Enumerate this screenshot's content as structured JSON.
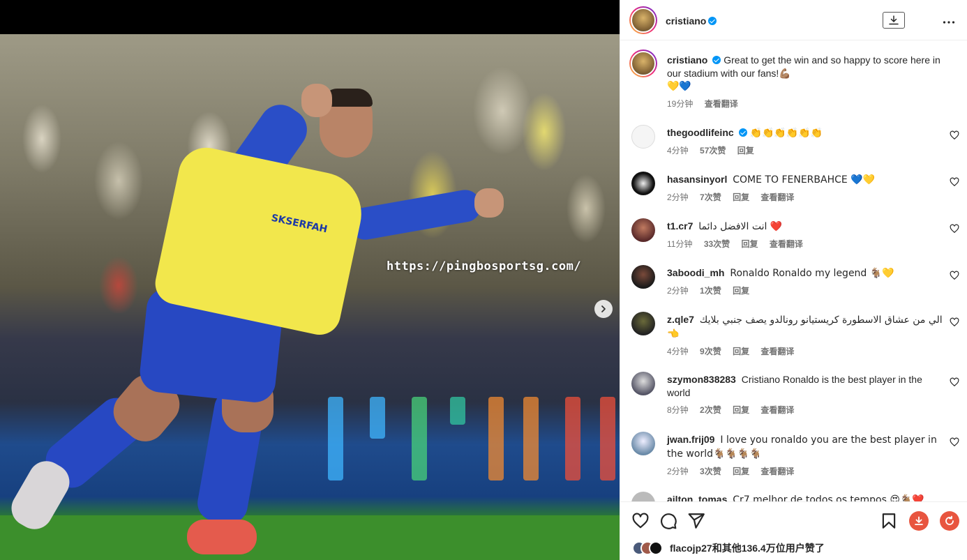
{
  "media": {
    "watermark": "https://pingbosportsg.com/",
    "sponsor_text": "SKSERFAH"
  },
  "header": {
    "username": "cristiano"
  },
  "caption": {
    "username": "cristiano",
    "text": "Great to get the win and so happy to score here in our stadium with our fans!💪🏽",
    "emoji_line": "💛💙",
    "time": "19分钟",
    "translate": "查看翻译"
  },
  "comments": [
    {
      "username": "thegoodlifeinc",
      "text": "👏👏👏👏👏👏",
      "time": "4分钟",
      "likes": "57次赞",
      "reply": "回复",
      "translate": ""
    },
    {
      "username": "hasansinyorl",
      "text": "COME TO FENERBAHCE 💙💛",
      "time": "2分钟",
      "likes": "7次赞",
      "reply": "回复",
      "translate": "查看翻译"
    },
    {
      "username": "t1.cr7",
      "text": "انت الافضل دائما ❤️",
      "time": "11分钟",
      "likes": "33次赞",
      "reply": "回复",
      "translate": "查看翻译"
    },
    {
      "username": "3aboodi_mh",
      "text": "Ronaldo Ronaldo my legend 🐐💛",
      "time": "2分钟",
      "likes": "1次赞",
      "reply": "回复",
      "translate": ""
    },
    {
      "username": "z.qle7",
      "text": "الي من عشاق الاسطورة كريستيانو رونالدو يصف جنبي بلايك 👈",
      "time": "4分钟",
      "likes": "9次赞",
      "reply": "回复",
      "translate": "查看翻译"
    },
    {
      "username": "szymon838283",
      "text": "Cristiano Ronaldo is the best player in the world",
      "time": "8分钟",
      "likes": "2次赞",
      "reply": "回复",
      "translate": "查看翻译"
    },
    {
      "username": "jwan.frij09",
      "text": "I love you ronaldo you are the best player in the world🐐🐐🐐🐐",
      "time": "2分钟",
      "likes": "3次赞",
      "reply": "回复",
      "translate": "查看翻译"
    },
    {
      "username": "ailton_tomas",
      "text": "Cr7 melhor de todos os tempos 😍🐐❤️",
      "time": "",
      "likes": "",
      "reply": "",
      "translate": ""
    }
  ],
  "likes_summary": {
    "text": "flacojp27和其他136.4万位用户赞了"
  },
  "icons": {
    "like": "heart-icon",
    "comment": "comment-bubble-icon",
    "share": "paper-plane-icon",
    "save": "bookmark-icon",
    "download": "download-icon",
    "refresh": "refresh-icon",
    "more": "more-horizontal-icon",
    "next": "chevron-right-icon"
  },
  "colors": {
    "verified": "#0095f6",
    "accent_button": "#e8553f",
    "meta_text": "#737373"
  }
}
